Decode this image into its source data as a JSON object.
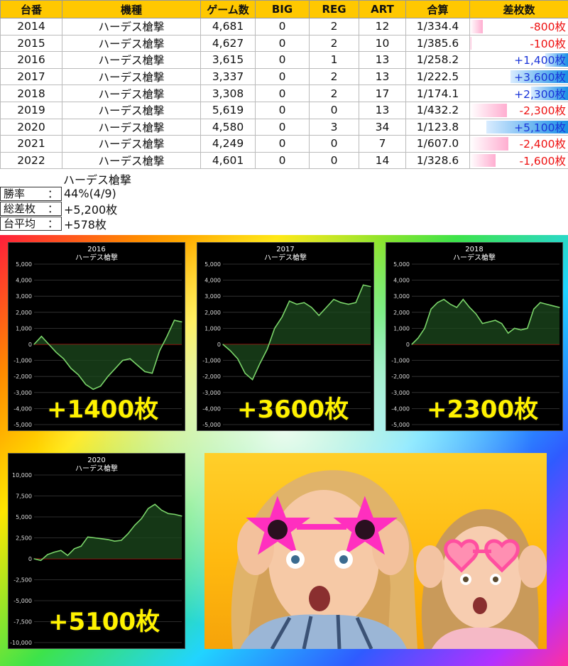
{
  "table": {
    "headers": [
      "台番",
      "機種",
      "ゲーム数",
      "BIG",
      "REG",
      "ART",
      "合算",
      "差枚数"
    ],
    "rows": [
      {
        "no": "2014",
        "machine": "ハーデス槍撃",
        "games": "4,681",
        "big": "0",
        "reg": "2",
        "art": "12",
        "rate": "1/334.4",
        "diff": "-800枚",
        "diff_value": -800
      },
      {
        "no": "2015",
        "machine": "ハーデス槍撃",
        "games": "4,627",
        "big": "0",
        "reg": "2",
        "art": "10",
        "rate": "1/385.6",
        "diff": "-100枚",
        "diff_value": -100
      },
      {
        "no": "2016",
        "machine": "ハーデス槍撃",
        "games": "3,615",
        "big": "0",
        "reg": "1",
        "art": "13",
        "rate": "1/258.2",
        "diff": "+1,400枚",
        "diff_value": 1400
      },
      {
        "no": "2017",
        "machine": "ハーデス槍撃",
        "games": "3,337",
        "big": "0",
        "reg": "2",
        "art": "13",
        "rate": "1/222.5",
        "diff": "+3,600枚",
        "diff_value": 3600
      },
      {
        "no": "2018",
        "machine": "ハーデス槍撃",
        "games": "3,308",
        "big": "0",
        "reg": "2",
        "art": "17",
        "rate": "1/174.1",
        "diff": "+2,300枚",
        "diff_value": 2300
      },
      {
        "no": "2019",
        "machine": "ハーデス槍撃",
        "games": "5,619",
        "big": "0",
        "reg": "0",
        "art": "13",
        "rate": "1/432.2",
        "diff": "-2,300枚",
        "diff_value": -2300
      },
      {
        "no": "2020",
        "machine": "ハーデス槍撃",
        "games": "4,580",
        "big": "0",
        "reg": "3",
        "art": "34",
        "rate": "1/123.8",
        "diff": "+5,100枚",
        "diff_value": 5100
      },
      {
        "no": "2021",
        "machine": "ハーデス槍撃",
        "games": "4,249",
        "big": "0",
        "reg": "0",
        "art": "7",
        "rate": "1/607.0",
        "diff": "-2,400枚",
        "diff_value": -2400
      },
      {
        "no": "2022",
        "machine": "ハーデス槍撃",
        "games": "4,601",
        "big": "0",
        "reg": "0",
        "art": "14",
        "rate": "1/328.6",
        "diff": "-1,600枚",
        "diff_value": -1600
      }
    ]
  },
  "summary": {
    "machine": "ハーデス槍撃",
    "win_rate_label": "勝率",
    "win_rate": "44%(4/9)",
    "total_label": "総差枚",
    "total": "+5,200枚",
    "avg_label": "台平均",
    "avg": "+578枚",
    "colon": "："
  },
  "colors": {
    "header_bg": "#ffc800",
    "positive_text": "#1a34d8",
    "negative_text": "#ee1111",
    "chart_line": "#7bd56a",
    "zero_line": "#d01010",
    "highlight_text": "#fff200"
  },
  "chart_data": [
    {
      "type": "area",
      "title": "2016",
      "subtitle": "ハーデス槍撃",
      "ylim": [
        -5000,
        5000
      ],
      "yticks": [
        "5,000",
        "4,000",
        "3,000",
        "2,000",
        "1,000",
        "0",
        "-1,000",
        "-2,000",
        "-3,000",
        "-4,000",
        "-5,000"
      ],
      "grid": true,
      "values": [
        0,
        500,
        0,
        -500,
        -900,
        -1500,
        -1900,
        -2500,
        -2800,
        -2600,
        -2000,
        -1500,
        -1000,
        -900,
        -1300,
        -1700,
        -1800,
        -400,
        500,
        1500,
        1400
      ],
      "label": "+1400枚"
    },
    {
      "type": "area",
      "title": "2017",
      "subtitle": "ハーデス槍撃",
      "ylim": [
        -5000,
        5000
      ],
      "yticks": [
        "5,000",
        "4,000",
        "3,000",
        "2,000",
        "1,000",
        "0",
        "-1,000",
        "-2,000",
        "-3,000",
        "-4,000",
        "-5,000"
      ],
      "grid": true,
      "values": [
        0,
        -400,
        -900,
        -1800,
        -2200,
        -1200,
        -300,
        1000,
        1700,
        2700,
        2500,
        2600,
        2300,
        1800,
        2300,
        2800,
        2600,
        2500,
        2600,
        3700,
        3600
      ],
      "label": "+3600枚"
    },
    {
      "type": "area",
      "title": "2018",
      "subtitle": "ハーデス槍撃",
      "ylim": [
        -5000,
        5000
      ],
      "yticks": [
        "5,000",
        "4,000",
        "3,000",
        "2,000",
        "1,000",
        "0",
        "-1,000",
        "-2,000",
        "-3,000",
        "-4,000",
        "-5,000"
      ],
      "grid": true,
      "values": [
        0,
        400,
        1000,
        2200,
        2600,
        2800,
        2500,
        2300,
        2800,
        2300,
        1900,
        1300,
        1400,
        1500,
        1300,
        700,
        1000,
        900,
        1000,
        2200,
        2600,
        2500,
        2400,
        2300
      ],
      "label": "+2300枚"
    },
    {
      "type": "area",
      "title": "2020",
      "subtitle": "ハーデス槍撃",
      "ylim": [
        -10000,
        10000
      ],
      "yticks": [
        "10,000",
        "7,500",
        "5,000",
        "2,500",
        "0",
        "-2,500",
        "-5,000",
        "-7,500",
        "-10,000"
      ],
      "grid": true,
      "values": [
        0,
        -200,
        500,
        800,
        1000,
        400,
        1200,
        1500,
        2600,
        2500,
        2400,
        2300,
        2100,
        2200,
        3000,
        4000,
        4800,
        6000,
        6500,
        5800,
        5400,
        5300,
        5100
      ],
      "label": "+5100枚"
    }
  ]
}
